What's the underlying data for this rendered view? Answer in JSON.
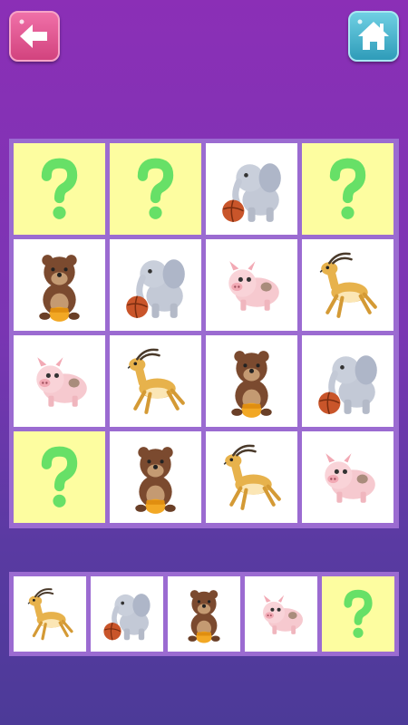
{
  "toolbar": {
    "back_icon": "back-arrow-icon",
    "home_icon": "house-icon"
  },
  "board": {
    "rows": [
      [
        "question",
        "question",
        "elephant",
        "question"
      ],
      [
        "bear",
        "elephant",
        "pig",
        "gazelle"
      ],
      [
        "pig",
        "gazelle",
        "bear",
        "elephant"
      ],
      [
        "question",
        "bear",
        "gazelle",
        "pig"
      ]
    ]
  },
  "choices": [
    "gazelle",
    "elephant",
    "bear",
    "pig",
    "question"
  ],
  "colors": {
    "question_tile": "#fdfda0",
    "question_mark": "#67e067",
    "back_button": "#e05a93",
    "home_button": "#45b3cc"
  }
}
